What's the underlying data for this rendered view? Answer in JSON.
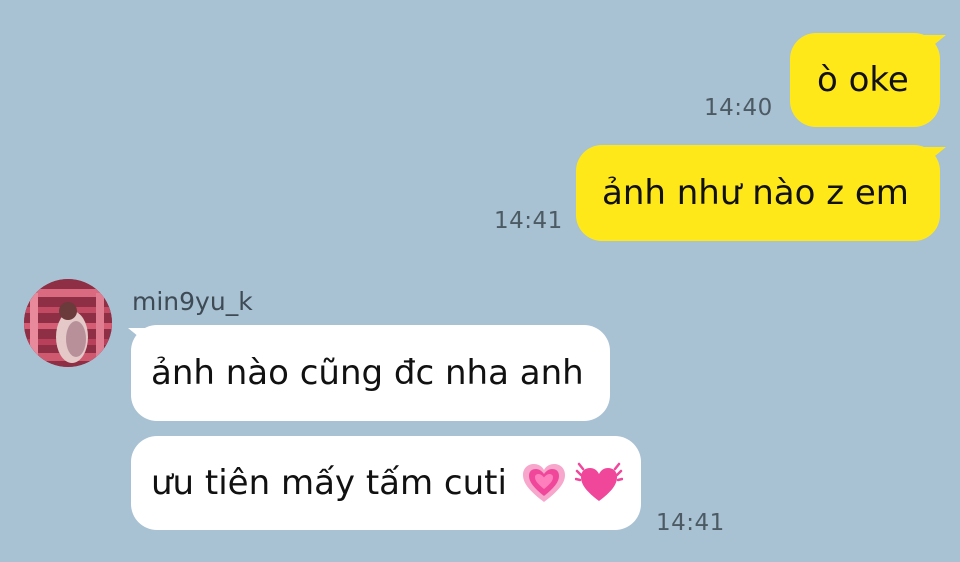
{
  "messages": [
    {
      "text": "ò oke",
      "time": "14:40"
    },
    {
      "text": "ảnh như nào z em",
      "time": "14:41"
    }
  ],
  "incoming": {
    "sender": "min9yu_k",
    "messages": [
      {
        "text": "ảnh nào cũng đc nha anh"
      },
      {
        "text": "ưu tiên mấy tấm cuti",
        "icons": [
          "growing-heart-icon",
          "beating-heart-icon"
        ]
      }
    ],
    "time": "14:41"
  },
  "colors": {
    "background": "#a8c1d3",
    "outgoing_bubble": "#ffe81a",
    "incoming_bubble": "#ffffff",
    "heart": "#f0479b"
  }
}
